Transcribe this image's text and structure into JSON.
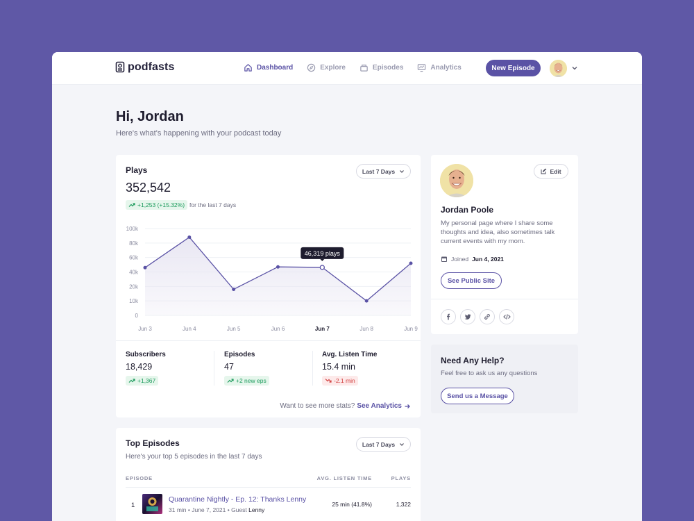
{
  "app": {
    "brand": "podfasts"
  },
  "nav": {
    "items": [
      {
        "label": "Dashboard",
        "icon": "home-icon",
        "active": true
      },
      {
        "label": "Explore",
        "icon": "compass-icon",
        "active": false
      },
      {
        "label": "Episodes",
        "icon": "folder-icon",
        "active": false
      },
      {
        "label": "Analytics",
        "icon": "chart-monitor-icon",
        "active": false
      }
    ],
    "new_episode_label": "New Episode"
  },
  "greeting": {
    "title": "Hi, Jordan",
    "subtitle": "Here's what's happening with your podcast today"
  },
  "plays": {
    "title": "Plays",
    "range_label": "Last 7 Days",
    "total": "352,542",
    "change": "+1,253 (+15.32%)",
    "change_note": "for the last 7 days",
    "tooltip": "46,319 plays"
  },
  "chart_data": {
    "type": "area",
    "categories": [
      "Jun 3",
      "Jun 4",
      "Jun 5",
      "Jun 6",
      "Jun 7",
      "Jun 8",
      "Jun 9"
    ],
    "values": [
      46000,
      88000,
      18000,
      47000,
      46319,
      10000,
      52000
    ],
    "highlight_index": 4,
    "ylim": [
      0,
      100000
    ],
    "y_ticks": [
      0,
      10000,
      20000,
      40000,
      60000,
      80000,
      100000
    ],
    "y_tick_labels": [
      "0",
      "10k",
      "20k",
      "40k",
      "60k",
      "80k",
      "100k"
    ],
    "grid": true,
    "colors": {
      "line": "#5a52a5",
      "fill": "#e9e7f3"
    }
  },
  "stats": [
    {
      "label": "Subscribers",
      "value": "18,429",
      "change": "+1,367",
      "direction": "up"
    },
    {
      "label": "Episodes",
      "value": "47",
      "change": "+2 new eps",
      "direction": "up"
    },
    {
      "label": "Avg. Listen Time",
      "value": "15.4 min",
      "change": "-2.1 min",
      "direction": "down"
    }
  ],
  "more_stats": {
    "prompt": "Want to see more stats?",
    "link": "See Analytics"
  },
  "profile": {
    "name": "Jordan Poole",
    "bio": "My personal page where I share some thoughts and idea, also sometimes talk current events with my mom.",
    "joined_label": "Joined",
    "joined_date": "Jun 4, 2021",
    "edit_label": "Edit",
    "public_site_label": "See Public Site",
    "social": [
      "facebook-icon",
      "twitter-icon",
      "link-icon",
      "code-icon"
    ]
  },
  "help": {
    "title": "Need Any Help?",
    "subtitle": "Feel free to ask us any questions",
    "button_label": "Send us a Message"
  },
  "top_episodes": {
    "title": "Top Episodes",
    "subtitle": "Here's your top 5 episodes in the last 7 days",
    "range_label": "Last 7 Days",
    "columns": {
      "episode": "EPISODE",
      "listen": "AVG. LISTEN TIME",
      "plays": "PLAYS"
    },
    "rows": [
      {
        "rank": "1",
        "title": "Quarantine Nightly - Ep. 12: Thanks Lenny",
        "meta": "31 min • June 7, 2021 • Guest",
        "guest": "Lenny",
        "listen": "25 min (41.8%)",
        "plays": "1,322"
      }
    ]
  },
  "colors": {
    "accent": "#5a52a5",
    "background": "#5f58a6",
    "up": "#1a9a5b",
    "down": "#d24040"
  }
}
